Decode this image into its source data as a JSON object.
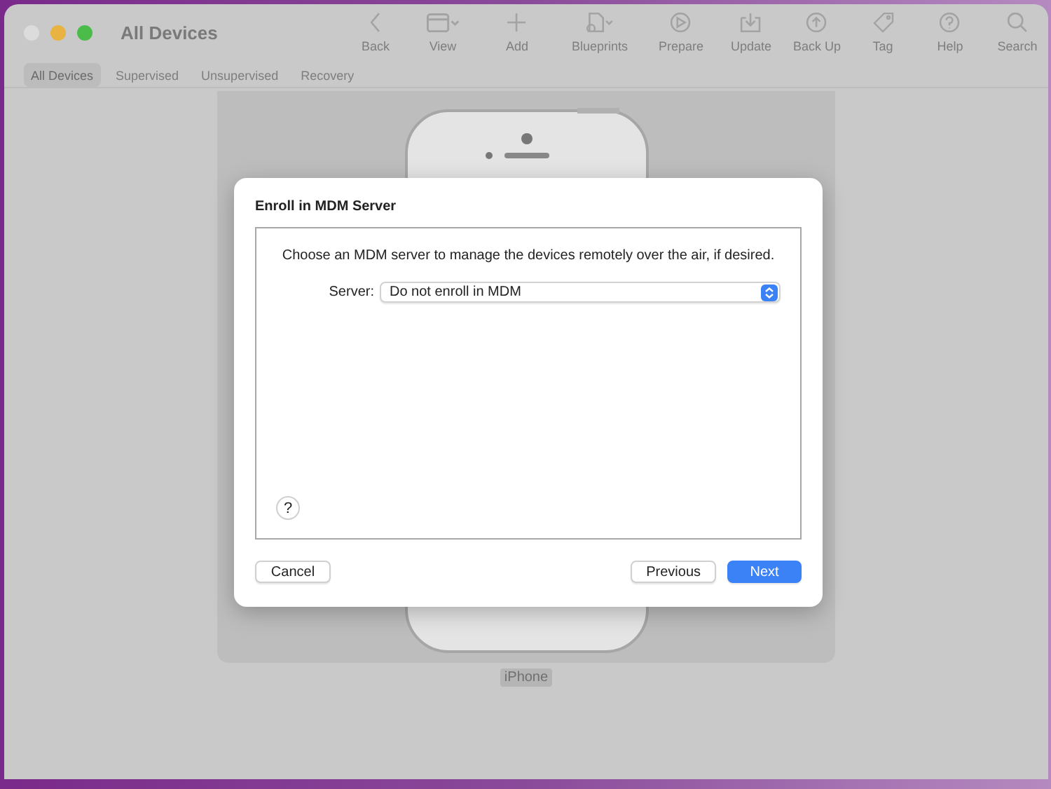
{
  "window": {
    "title": "All Devices"
  },
  "toolbar": [
    {
      "label": "Back"
    },
    {
      "label": "View"
    },
    {
      "label": "Add"
    },
    {
      "label": "Blueprints"
    },
    {
      "label": "Prepare"
    },
    {
      "label": "Update"
    },
    {
      "label": "Back Up"
    },
    {
      "label": "Tag"
    },
    {
      "label": "Help"
    },
    {
      "label": "Search"
    }
  ],
  "tabs": [
    {
      "label": "All Devices",
      "selected": true
    },
    {
      "label": "Supervised",
      "selected": false
    },
    {
      "label": "Unsupervised",
      "selected": false
    },
    {
      "label": "Recovery",
      "selected": false
    }
  ],
  "device": {
    "name": "iPhone"
  },
  "dialog": {
    "title": "Enroll in MDM Server",
    "message": "Choose an MDM server to manage the devices remotely over the air, if desired.",
    "server_label": "Server:",
    "server_value": "Do not enroll in MDM",
    "help": "?",
    "buttons": [
      {
        "label": "Cancel",
        "primary": false
      },
      {
        "label": "Previous",
        "primary": false
      },
      {
        "label": "Next",
        "primary": true
      }
    ]
  }
}
